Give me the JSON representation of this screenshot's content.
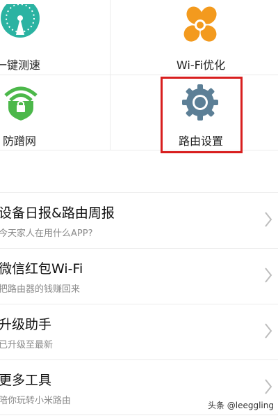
{
  "grid": {
    "items": [
      {
        "label": "一键测速",
        "icon": "speedometer-icon"
      },
      {
        "label": "Wi-Fi优化",
        "icon": "fan-icon"
      },
      {
        "label": "防蹭网",
        "icon": "wifi-shield-icon"
      },
      {
        "label": "路由设置",
        "icon": "gear-icon"
      }
    ]
  },
  "list": {
    "items": [
      {
        "title": "设备日报&路由周报",
        "subtitle": "今天家人在用什么APP?"
      },
      {
        "title": "微信红包Wi-Fi",
        "subtitle": "把路由器的钱赚回来"
      },
      {
        "title": "升级助手",
        "subtitle": "已升级至最新"
      },
      {
        "title": "更多工具",
        "subtitle": "陪你玩转小米路由"
      }
    ]
  },
  "watermark": "头条 @leeggling",
  "colors": {
    "speed_icon": "#2bb3a2",
    "fan_icon": "#f39a1e",
    "shield_icon": "#4cb84a",
    "gear_icon": "#5c7f96",
    "highlight_border": "#d81e1e"
  }
}
